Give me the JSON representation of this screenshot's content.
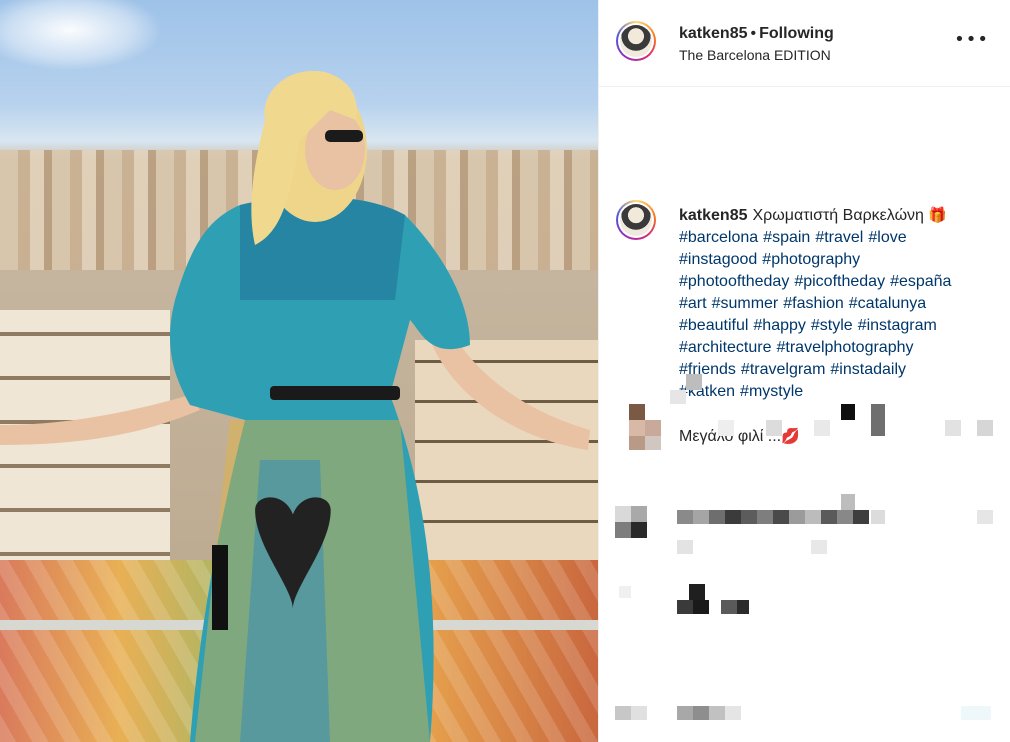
{
  "post": {
    "username": "katken85",
    "separator": "•",
    "follow_label": "Following",
    "location": "The Barcelona EDITION",
    "more_icon": "more-options-icon",
    "more_glyph": "•••"
  },
  "caption": {
    "username": "katken85",
    "text": "Χρωματιστή Βαρκελώνη",
    "text_emoji": "🎁",
    "hashtags": [
      "#barcelona",
      "#spain",
      "#travel",
      "#love",
      "#instagood",
      "#photography",
      "#photooftheday",
      "#picoftheday",
      "#españa",
      "#art",
      "#summer",
      "#fashion",
      "#catalunya",
      "#beautiful",
      "#happy",
      "#style",
      "#instagram",
      "#architecture",
      "#travelphotography",
      "#friends",
      "#travelgram",
      "#instadaily",
      "#katken",
      "#mystyle"
    ],
    "line2": "Μεγάλο φιλί ...",
    "line2_emoji": "💋"
  },
  "colors": {
    "text": "#262626",
    "hashtag": "#00376b",
    "border": "#efefef",
    "story_ring": [
      "#feda75",
      "#fa7e1e",
      "#d62976",
      "#962fbf",
      "#4f5bd5"
    ]
  }
}
